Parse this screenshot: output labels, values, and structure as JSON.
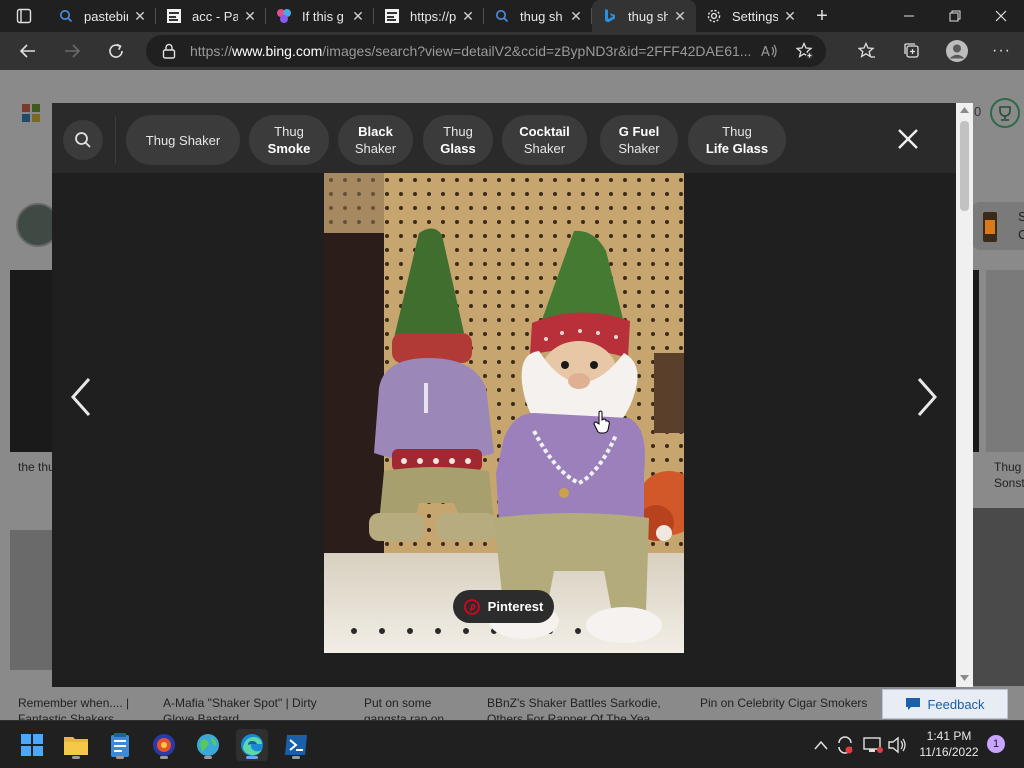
{
  "browser": {
    "tabs": [
      {
        "title": "pastebin",
        "icon": "search-icon"
      },
      {
        "title": "acc - Pa",
        "icon": "pastebin-icon"
      },
      {
        "title": "If this g",
        "icon": "colorful-icon"
      },
      {
        "title": "https://p",
        "icon": "pastebin-icon"
      },
      {
        "title": "thug sh",
        "icon": "search-icon"
      },
      {
        "title": "thug sh",
        "icon": "bing-icon",
        "active": true
      },
      {
        "title": "Settings",
        "icon": "gear-icon"
      }
    ],
    "url_prefix": "https://",
    "url_host": "www.bing.com",
    "url_path": "/images/search?view=detailV2&ccid=zBypND3r&id=2FFF42DAE61..."
  },
  "overlay": {
    "chips": [
      {
        "line1": "Thug Shaker",
        "line2": ""
      },
      {
        "line1": "Thug",
        "line2": "Smoke"
      },
      {
        "line1": "Black",
        "line2": "Shaker"
      },
      {
        "line1": "Thug",
        "line2": "Glass"
      },
      {
        "line1": "Cocktail",
        "line2": "Shaker"
      },
      {
        "line1": "G Fuel",
        "line2": "Shaker"
      },
      {
        "line1": "Thug",
        "line2": "Life Glass"
      }
    ],
    "source_label": "Pinterest"
  },
  "background_results": {
    "captions": [
      "the thu",
      "Thug",
      "Sonst",
      "Remember when.... |",
      "Fantastic Shakers",
      "A-Mafia \"Shaker Spot\" | Dirty",
      "Glove Bastard",
      "Put on some",
      "gangsta rap on",
      "BBnZ's Shaker Battles Sarkodie,",
      "Others For Rapper Of The Yea",
      "Pin on Celebrity Cigar Smokers"
    ],
    "side_letters": [
      "S",
      "C"
    ],
    "partial_zero": "0"
  },
  "feedback_label": "Feedback",
  "taskbar": {
    "time": "1:41 PM",
    "date": "11/16/2022",
    "notifications": "1"
  },
  "colors": {
    "accent": "#6aa5ff",
    "pinterest": "#e60023"
  }
}
